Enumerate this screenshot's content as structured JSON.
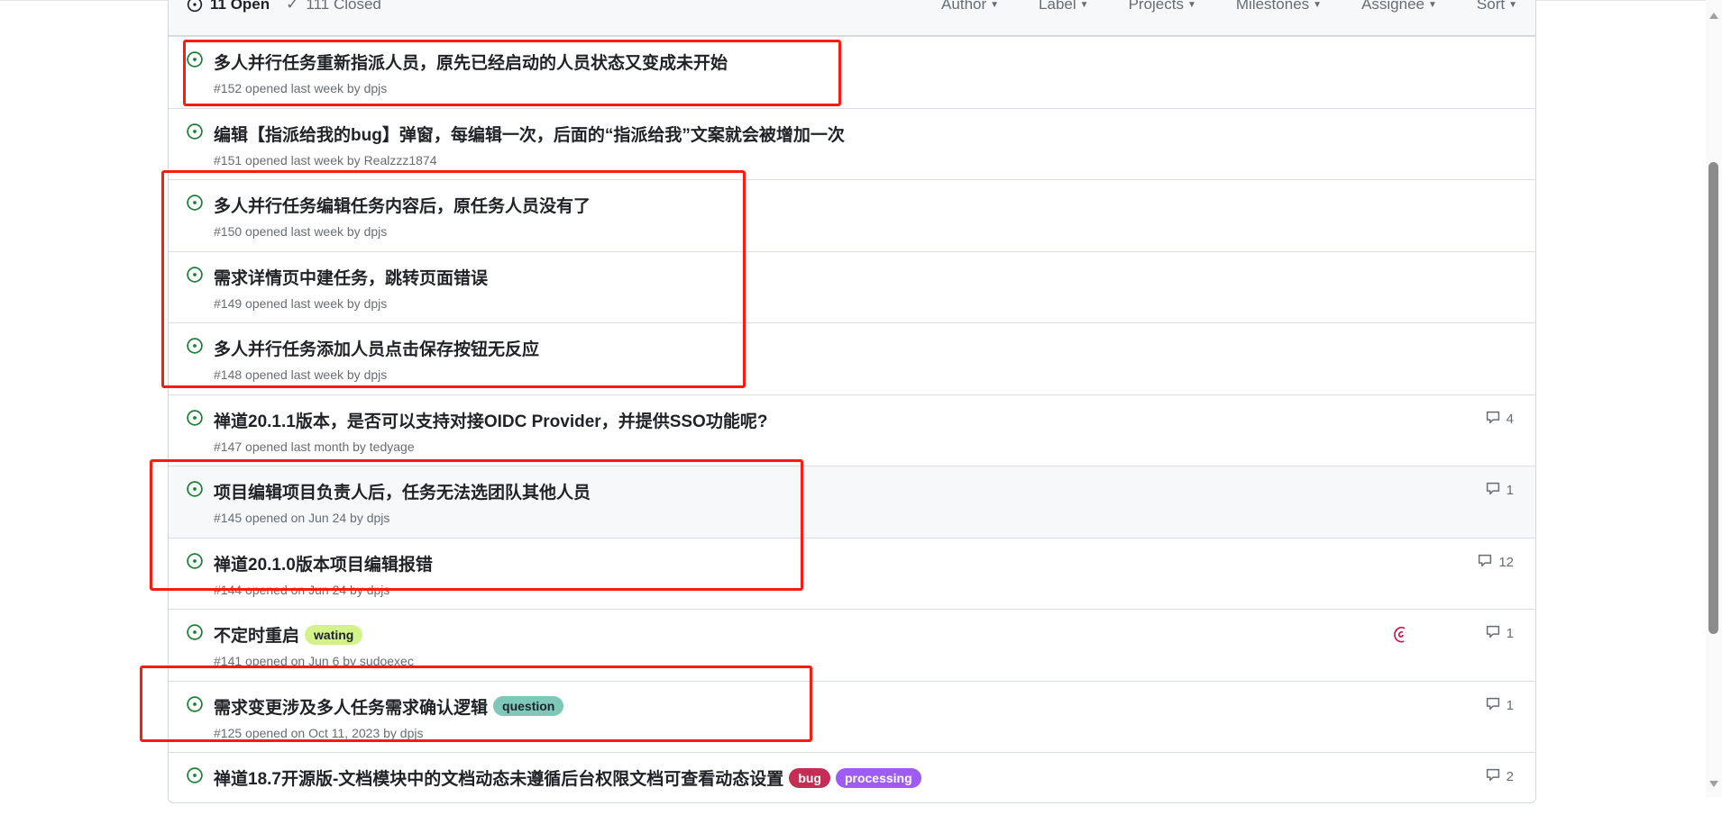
{
  "header": {
    "open_label": "11 Open",
    "closed_label": "111 Closed",
    "filters": [
      "Author",
      "Label",
      "Projects",
      "Milestones",
      "Assignee",
      "Sort"
    ]
  },
  "colors": {
    "open_icon": "#1a7f37",
    "highlight": "#ff1a0f"
  },
  "issues": [
    {
      "title": "多人并行任务重新指派人员，原先已经启动的人员状态又变成未开始",
      "meta": "#152 opened last week by dpjs"
    },
    {
      "title": "编辑【指派给我的bug】弹窗，每编辑一次，后面的“指派给我”文案就会被增加一次",
      "meta": "#151 opened last week by Realzzz1874"
    },
    {
      "title": "多人并行任务编辑任务内容后，原任务人员没有了",
      "meta": "#150 opened last week by dpjs"
    },
    {
      "title": "需求详情页中建任务，跳转页面错误",
      "meta": "#149 opened last week by dpjs"
    },
    {
      "title": "多人并行任务添加人员点击保存按钮无反应",
      "meta": "#148 opened last week by dpjs"
    },
    {
      "title": "禅道20.1.1版本，是否可以支持对接OIDC Provider，并提供SSO功能呢?",
      "meta": "#147 opened last month by tedyage",
      "comments": "4"
    },
    {
      "title": "项目编辑项目负责人后，任务无法选团队其他人员",
      "meta": "#145 opened on Jun 24 by dpjs",
      "comments": "1"
    },
    {
      "title": "禅道20.1.0版本项目编辑报错",
      "meta": "#144 opened on Jun 24 by dpjs",
      "comments": "12"
    },
    {
      "title": "不定时重启",
      "meta": "#141 opened on Jun 6 by sudoexec",
      "comments": "1",
      "labels": [
        {
          "text": "wating",
          "bg": "#d4f28a",
          "fg": "#1f2328"
        }
      ]
    },
    {
      "title": "需求变更涉及多人任务需求确认逻辑",
      "meta": "#125 opened on Oct 11, 2023 by dpjs",
      "comments": "1",
      "labels": [
        {
          "text": "question",
          "bg": "#7fc8b8",
          "fg": "#1f2328"
        }
      ]
    },
    {
      "title": "禅道18.7开源版-文档模块中的文档动态未遵循后台权限文档可查看动态设置",
      "meta": "",
      "comments": "2",
      "labels": [
        {
          "text": "bug",
          "bg": "#c62d55",
          "fg": "#ffffff"
        },
        {
          "text": "processing",
          "bg": "#9f5cf5",
          "fg": "#ffffff"
        }
      ]
    }
  ]
}
